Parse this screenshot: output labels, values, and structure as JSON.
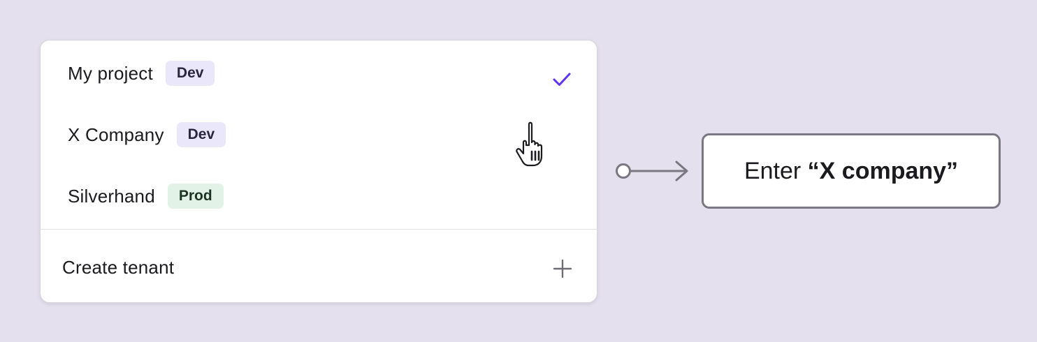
{
  "tenants": [
    {
      "name": "My project",
      "badge": "Dev",
      "selected": true
    },
    {
      "name": "X Company",
      "badge": "Dev",
      "selected": false
    },
    {
      "name": "Silverhand",
      "badge": "Prod",
      "selected": false
    }
  ],
  "create_tenant": {
    "label": "Create tenant",
    "icon": "plus-icon"
  },
  "callout": {
    "prefix": "Enter ",
    "value": "“X company”"
  },
  "colors": {
    "background": "#e4e0ed",
    "check": "#5d34f2",
    "dev_badge": "#ebe7fb",
    "prod_badge": "#e2f2e6",
    "connector": "#7a7782"
  }
}
